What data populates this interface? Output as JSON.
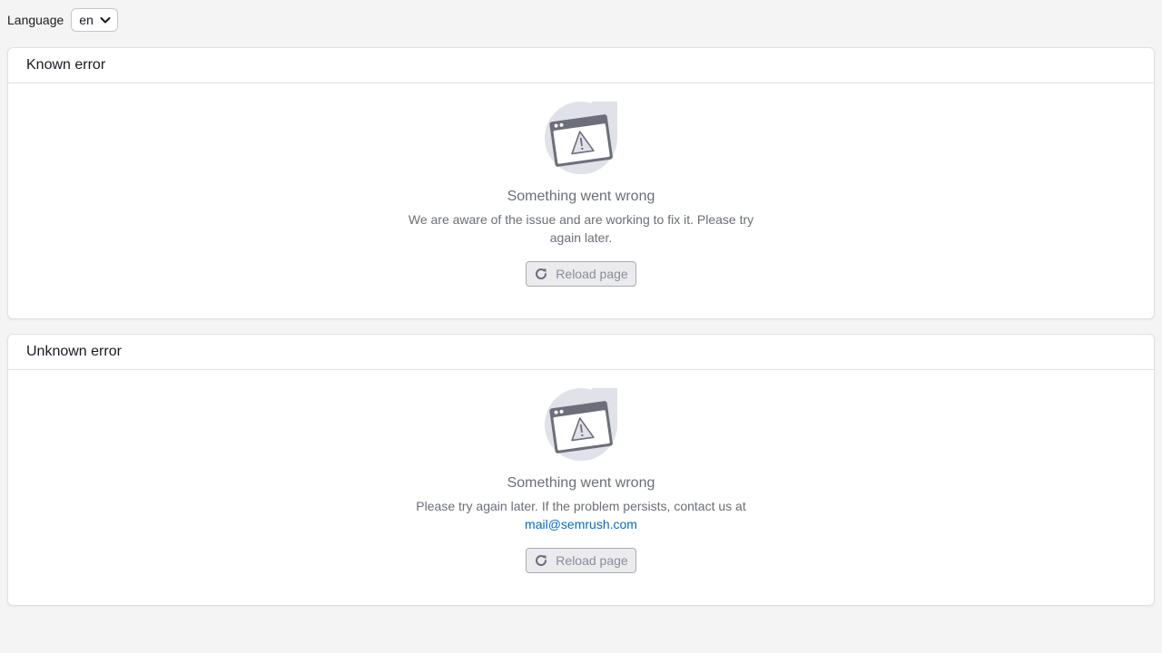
{
  "language_bar": {
    "label": "Language",
    "selected": "en"
  },
  "known_error": {
    "header": "Known error",
    "icon": "error-window-icon",
    "title": "Something went wrong",
    "text": "We are aware of the issue and are working to fix it. Please try again later.",
    "reload_label": "Reload page"
  },
  "unknown_error": {
    "header": "Unknown error",
    "icon": "error-window-icon",
    "title": "Something went wrong",
    "text": "Please try again later. If the problem persists, contact us at",
    "email": "mail@semrush.com",
    "reload_label": "Reload page"
  },
  "colors": {
    "accent_link": "#006dca",
    "muted_text": "#6c6e79",
    "illustration_bg": "#e0e1e9",
    "illustration_dark": "#6c6e79"
  }
}
